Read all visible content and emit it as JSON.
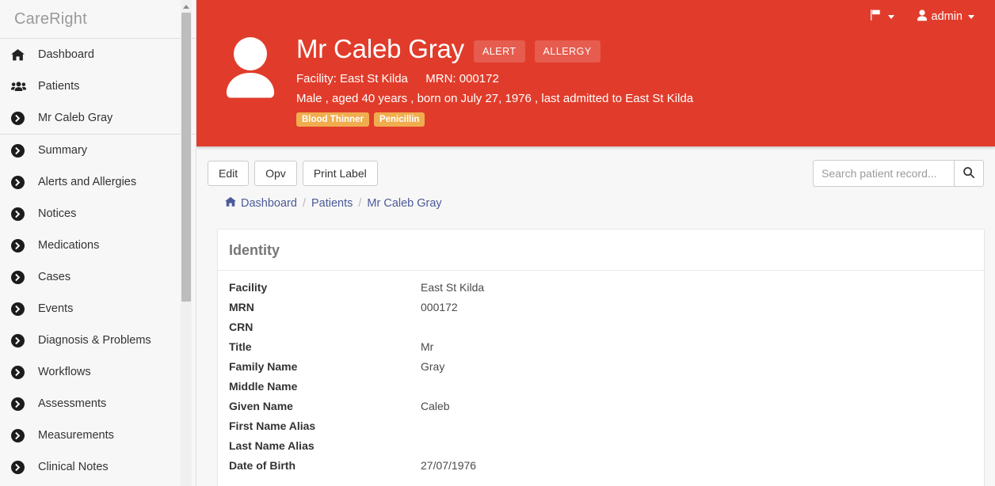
{
  "sidebar": {
    "brand": "CareRight",
    "items": [
      {
        "label": "Dashboard",
        "icon": "home-icon"
      },
      {
        "label": "Patients",
        "icon": "users-icon"
      },
      {
        "label": "Mr Caleb Gray",
        "icon": "chevron-circle-right-icon"
      },
      {
        "label": "Summary",
        "icon": "chevron-circle-right-icon"
      },
      {
        "label": "Alerts and Allergies",
        "icon": "chevron-circle-right-icon"
      },
      {
        "label": "Notices",
        "icon": "chevron-circle-right-icon"
      },
      {
        "label": "Medications",
        "icon": "chevron-circle-right-icon"
      },
      {
        "label": "Cases",
        "icon": "chevron-circle-right-icon"
      },
      {
        "label": "Events",
        "icon": "chevron-circle-right-icon"
      },
      {
        "label": "Diagnosis & Problems",
        "icon": "chevron-circle-right-icon"
      },
      {
        "label": "Workflows",
        "icon": "chevron-circle-right-icon"
      },
      {
        "label": "Assessments",
        "icon": "chevron-circle-right-icon"
      },
      {
        "label": "Measurements",
        "icon": "chevron-circle-right-icon"
      },
      {
        "label": "Clinical Notes",
        "icon": "chevron-circle-right-icon"
      }
    ]
  },
  "topnav": {
    "flag_icon": "flag-icon",
    "user_icon": "user-icon",
    "user_label": "admin"
  },
  "banner": {
    "accent_color": "#e13c2b",
    "avatar_icon": "user-avatar-icon",
    "patient_name": "Mr Caleb Gray",
    "badges": [
      "ALERT",
      "ALLERGY"
    ],
    "facility_label": "Facility:",
    "facility_value": "East St Kilda",
    "mrn_label": "MRN:",
    "mrn_value": "000172",
    "demographics": "Male , aged 40 years , born on July 27, 1976 , last admitted to East St Kilda",
    "tags": [
      "Blood Thinner",
      "Penicillin"
    ],
    "tag_color": "#f0ad4e"
  },
  "toolbar": {
    "buttons": [
      "Edit",
      "Opv",
      "Print Label"
    ],
    "search_placeholder": "Search patient record...",
    "search_value": "",
    "search_icon": "search-icon"
  },
  "breadcrumb": {
    "home_icon": "home-icon",
    "items": [
      "Dashboard",
      "Patients",
      "Mr Caleb Gray"
    ],
    "separator": "/",
    "link_color": "#4b5a99"
  },
  "identity_card": {
    "title": "Identity",
    "rows": [
      {
        "key": "Facility",
        "value": "East St Kilda"
      },
      {
        "key": "MRN",
        "value": "000172"
      },
      {
        "key": "CRN",
        "value": ""
      },
      {
        "key": "Title",
        "value": "Mr"
      },
      {
        "key": "Family Name",
        "value": "Gray"
      },
      {
        "key": "Middle Name",
        "value": ""
      },
      {
        "key": "Given Name",
        "value": "Caleb"
      },
      {
        "key": "First Name Alias",
        "value": ""
      },
      {
        "key": "Last Name Alias",
        "value": ""
      },
      {
        "key": "Date of Birth",
        "value": "27/07/1976"
      }
    ]
  }
}
